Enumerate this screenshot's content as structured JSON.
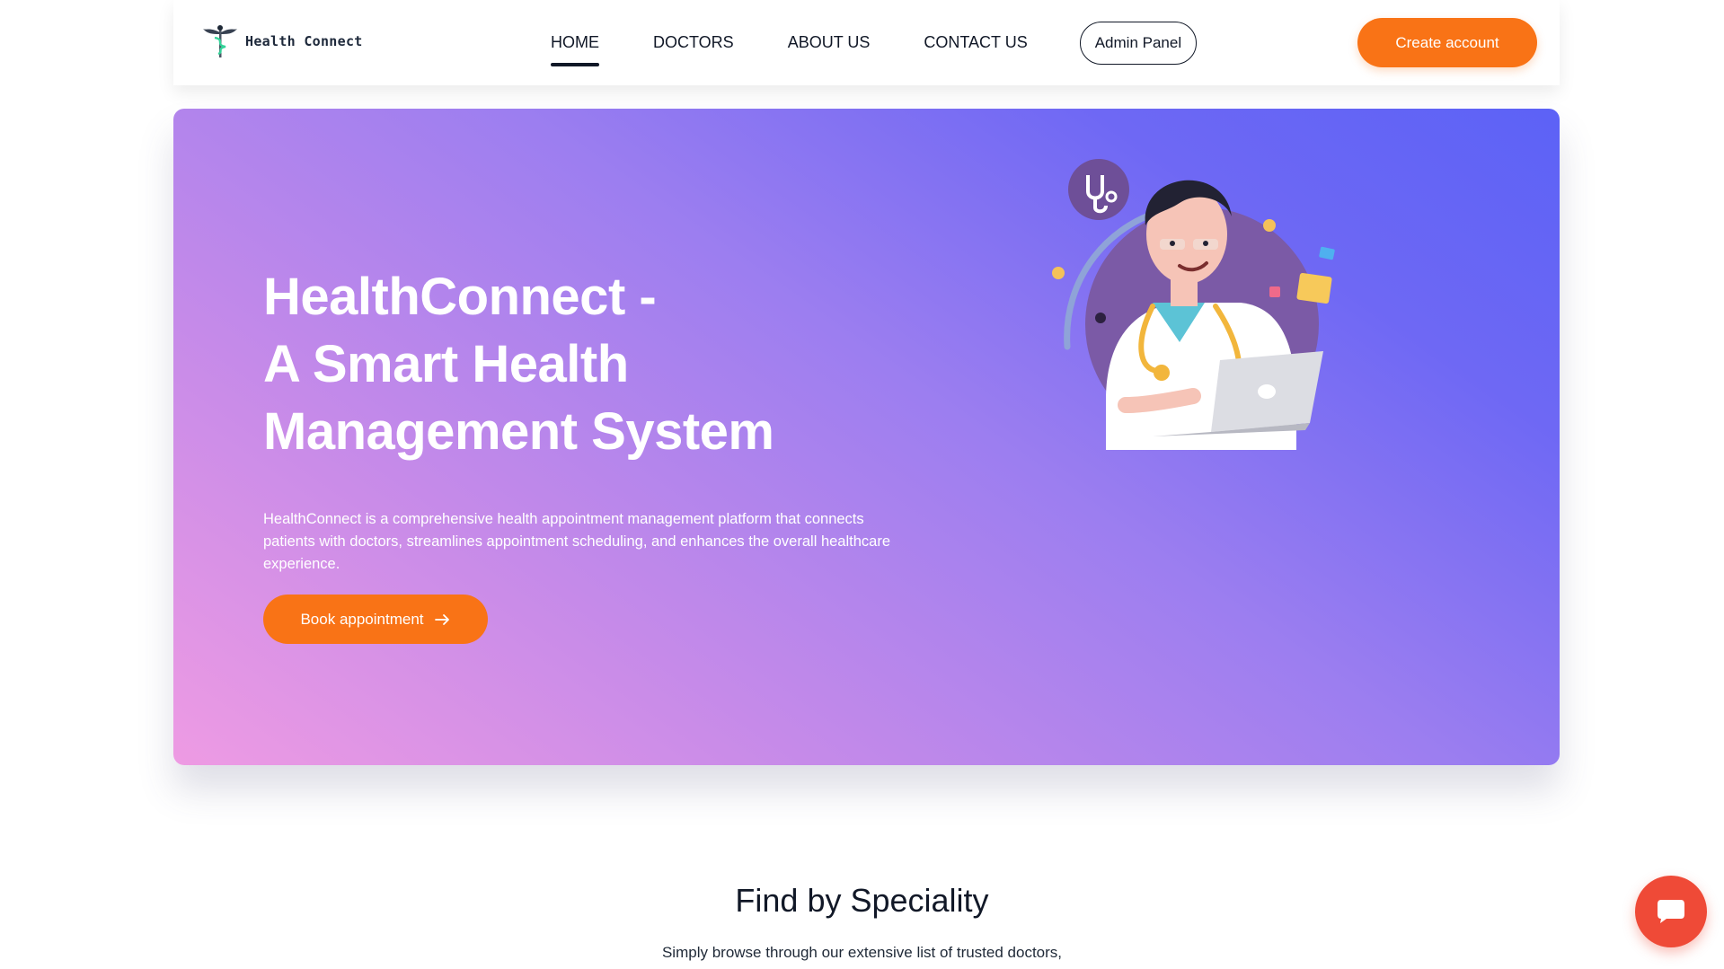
{
  "brand": {
    "name": "Health Connect"
  },
  "nav": {
    "links": [
      {
        "label": "HOME",
        "active": true
      },
      {
        "label": "DOCTORS",
        "active": false
      },
      {
        "label": "ABOUT US",
        "active": false
      },
      {
        "label": "CONTACT US",
        "active": false
      }
    ],
    "admin_label": "Admin Panel",
    "create_label": "Create account"
  },
  "hero": {
    "title_lines": [
      "HealthConnect -",
      "A Smart Health",
      "Management System"
    ],
    "description": "HealthConnect is a comprehensive health appointment management platform that connects patients with doctors, streamlines appointment scheduling, and enhances the overall healthcare experience.",
    "cta_label": "Book appointment",
    "cta_icon": "arrow-right-icon",
    "illustration": "doctor-with-laptop-illustration"
  },
  "speciality": {
    "title": "Find by Speciality",
    "description": "Simply browse through our extensive list of trusted doctors,"
  },
  "chat": {
    "icon": "chat-bubble-icon"
  },
  "colors": {
    "accent": "#f97316",
    "chat": "#ef4a37",
    "hero_gradient_start": "#ee9be3",
    "hero_gradient_end": "#5c62f6"
  }
}
